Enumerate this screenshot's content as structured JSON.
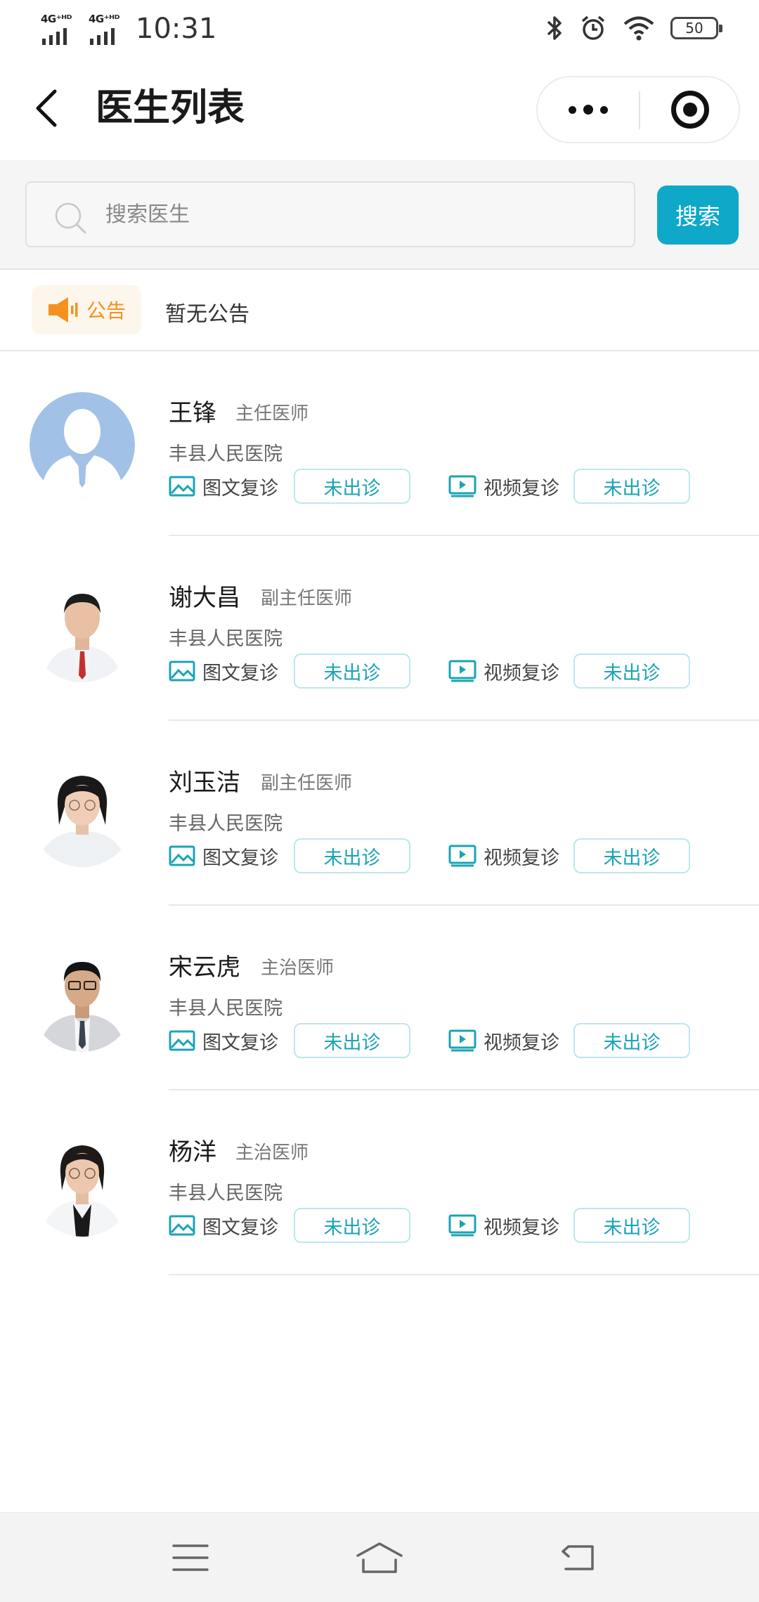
{
  "status_bar": {
    "network_1": "4G⁺ᴴᴰ",
    "network_2": "4G⁺ᴴᴰ",
    "time": "10:31",
    "battery": "50",
    "icons": [
      "bluetooth-icon",
      "alarm-icon",
      "wifi-icon",
      "battery-icon"
    ]
  },
  "header": {
    "title": "医生列表",
    "back_icon": "chevron-left-icon",
    "more_icon": "more-dots-icon",
    "close_icon": "target-icon"
  },
  "search": {
    "placeholder": "搜索医生",
    "value": "",
    "button_label": "搜索"
  },
  "notice": {
    "badge_label": "公告",
    "text": "暂无公告"
  },
  "services": {
    "text_consult": "图文复诊",
    "video_consult": "视频复诊"
  },
  "doctors": [
    {
      "name": "王锋",
      "title": "主任医师",
      "hospital": "丰县人民医院",
      "text_status": "未出诊",
      "video_status": "未出诊"
    },
    {
      "name": "谢大昌",
      "title": "副主任医师",
      "hospital": "丰县人民医院",
      "text_status": "未出诊",
      "video_status": "未出诊"
    },
    {
      "name": "刘玉洁",
      "title": "副主任医师",
      "hospital": "丰县人民医院",
      "text_status": "未出诊",
      "video_status": "未出诊"
    },
    {
      "name": "宋云虎",
      "title": "主治医师",
      "hospital": "丰县人民医院",
      "text_status": "未出诊",
      "video_status": "未出诊"
    },
    {
      "name": "杨洋",
      "title": "主治医师",
      "hospital": "丰县人民医院",
      "text_status": "未出诊",
      "video_status": "未出诊"
    }
  ],
  "colors": {
    "accent": "#0fa8c9",
    "status_text": "#1aa4b5",
    "notice_orange": "#f5921e"
  }
}
